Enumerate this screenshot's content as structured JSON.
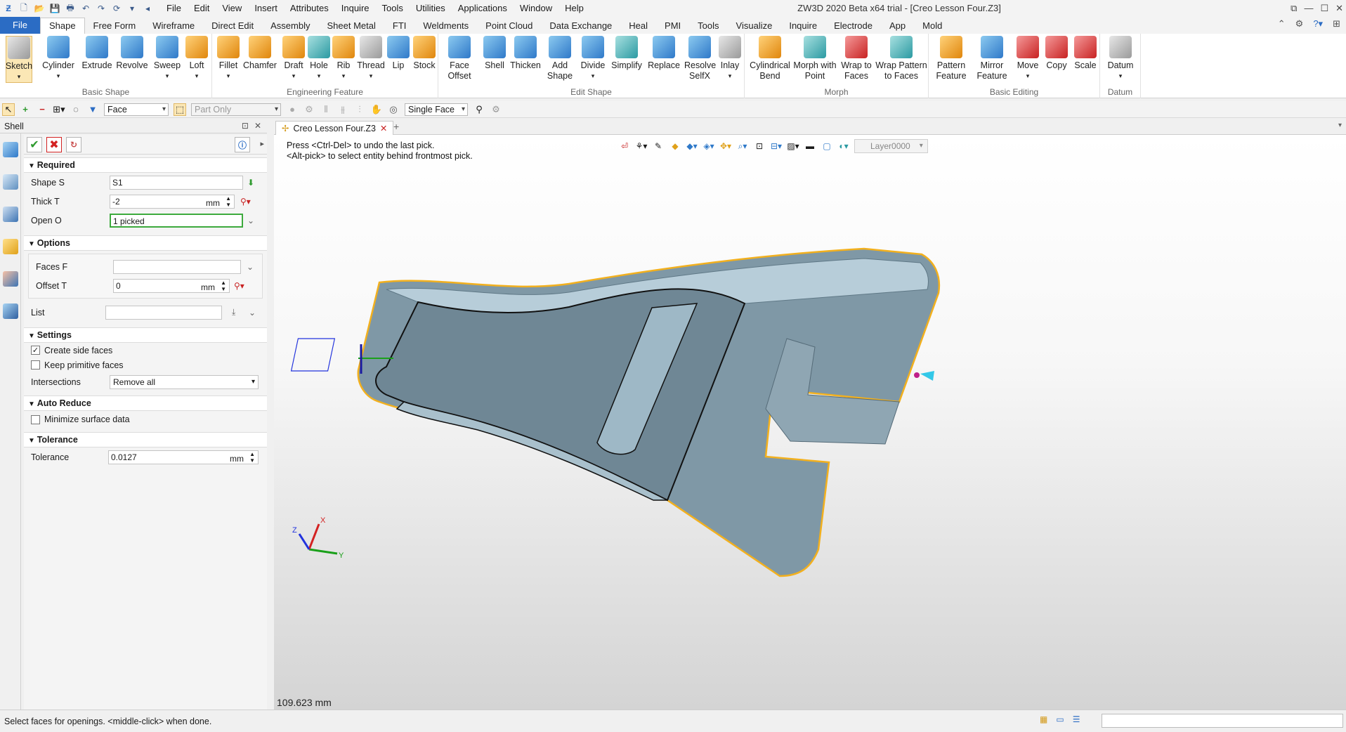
{
  "app_title": "ZW3D 2020 Beta x64 trial - [Creo Lesson Four.Z3]",
  "menu": [
    "File",
    "Edit",
    "View",
    "Insert",
    "Attributes",
    "Inquire",
    "Tools",
    "Utilities",
    "Applications",
    "Window",
    "Help"
  ],
  "ribbon_tabs": [
    "File",
    "Shape",
    "Free Form",
    "Wireframe",
    "Direct Edit",
    "Assembly",
    "Sheet Metal",
    "FTI",
    "Weldments",
    "Point Cloud",
    "Data Exchange",
    "Heal",
    "PMI",
    "Tools",
    "Visualize",
    "Inquire",
    "Electrode",
    "App",
    "Mold"
  ],
  "ribbon": {
    "basic_shape": {
      "label": "Basic Shape",
      "buttons": [
        "Sketch",
        "Cylinder",
        "Extrude",
        "Revolve",
        "Sweep",
        "Loft"
      ]
    },
    "engineering_feature": {
      "label": "Engineering Feature",
      "buttons": [
        "Fillet",
        "Chamfer",
        "Draft",
        "Hole",
        "Rib",
        "Thread",
        "Lip",
        "Stock"
      ]
    },
    "edit_shape": {
      "label": "Edit Shape",
      "buttons": [
        "Face Offset",
        "Shell",
        "Thicken",
        "Add Shape",
        "Divide",
        "Simplify",
        "Replace",
        "Resolve SelfX",
        "Inlay"
      ]
    },
    "morph": {
      "label": "Morph",
      "buttons": [
        "Cylindrical Bend",
        "Morph with Point",
        "Wrap to Faces",
        "Wrap Pattern to Faces"
      ]
    },
    "basic_editing": {
      "label": "Basic Editing",
      "buttons": [
        "Pattern Feature",
        "Mirror Feature",
        "Move",
        "Copy",
        "Scale"
      ]
    },
    "datum": {
      "label": "Datum",
      "buttons": [
        "Datum"
      ]
    }
  },
  "toolbar": {
    "filter": "Face",
    "scope": "Part Only",
    "pick_mode": "Single Face"
  },
  "panel": {
    "title": "Shell",
    "required": {
      "label": "Required",
      "shape_label": "Shape S",
      "shape_value": "S1",
      "thick_label": "Thick T",
      "thick_value": "-2",
      "thick_unit": "mm",
      "open_label": "Open O",
      "open_value": "1 picked"
    },
    "options": {
      "label": "Options",
      "faces_label": "Faces F",
      "faces_value": "",
      "offset_label": "Offset T",
      "offset_value": "0",
      "offset_unit": "mm",
      "list_label": "List",
      "list_value": ""
    },
    "settings": {
      "label": "Settings",
      "create_side_faces": "Create side faces",
      "create_side_faces_checked": true,
      "keep_primitive_faces": "Keep primitive faces",
      "keep_primitive_faces_checked": false,
      "intersections_label": "Intersections",
      "intersections_value": "Remove all"
    },
    "auto_reduce": {
      "label": "Auto Reduce",
      "minimize": "Minimize surface data",
      "minimize_checked": false
    },
    "tolerance": {
      "label": "Tolerance",
      "tolerance_label": "Tolerance",
      "tolerance_value": "0.0127",
      "tolerance_unit": "mm"
    }
  },
  "document_tab": "Creo Lesson Four.Z3",
  "viewport": {
    "hint_line1": "Press <Ctrl-Del> to undo the last pick.",
    "hint_line2": "<Alt-pick> to select entity behind frontmost pick.",
    "layer": "Layer0000",
    "scale_readout": "109.623 mm",
    "triad_x": "X",
    "triad_y": "Y",
    "triad_z": "Z"
  },
  "status_message": "Select faces for openings. <middle-click> when done.",
  "colors": {
    "accent": "#2b6cc4",
    "model_fill": "#7f98a6",
    "highlight": "#f2b01e",
    "ok_green": "#2f9a2f",
    "cancel_red": "#d32222"
  }
}
